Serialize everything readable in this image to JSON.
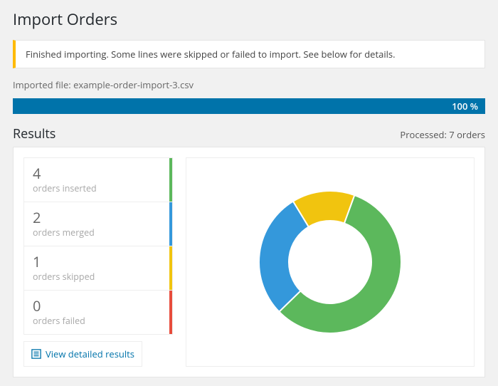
{
  "header": {
    "title": "Import Orders"
  },
  "notice": {
    "text": "Finished importing. Some lines were skipped or failed to import. See below for details."
  },
  "import": {
    "file_label": "Imported file:",
    "file_name": "example-order-import-3.csv",
    "progress_text": "100 %",
    "progress_pct": 100
  },
  "results": {
    "heading": "Results",
    "processed_text": "Processed: 7 orders",
    "stats": [
      {
        "count": "4",
        "label": "orders inserted",
        "color": "#5cb85c"
      },
      {
        "count": "2",
        "label": "orders merged",
        "color": "#3498db"
      },
      {
        "count": "1",
        "label": "orders skipped",
        "color": "#f1c40f"
      },
      {
        "count": "0",
        "label": "orders failed",
        "color": "#e74c3c"
      }
    ],
    "view_detailed_label": "View detailed results"
  },
  "chart_data": {
    "type": "pie",
    "title": "",
    "categories": [
      "orders inserted",
      "orders merged",
      "orders skipped",
      "orders failed"
    ],
    "values": [
      4,
      2,
      1,
      0
    ],
    "series_colors": {
      "orders inserted": "#5cb85c",
      "orders merged": "#3498db",
      "orders skipped": "#f1c40f",
      "orders failed": "#e74c3c"
    }
  }
}
